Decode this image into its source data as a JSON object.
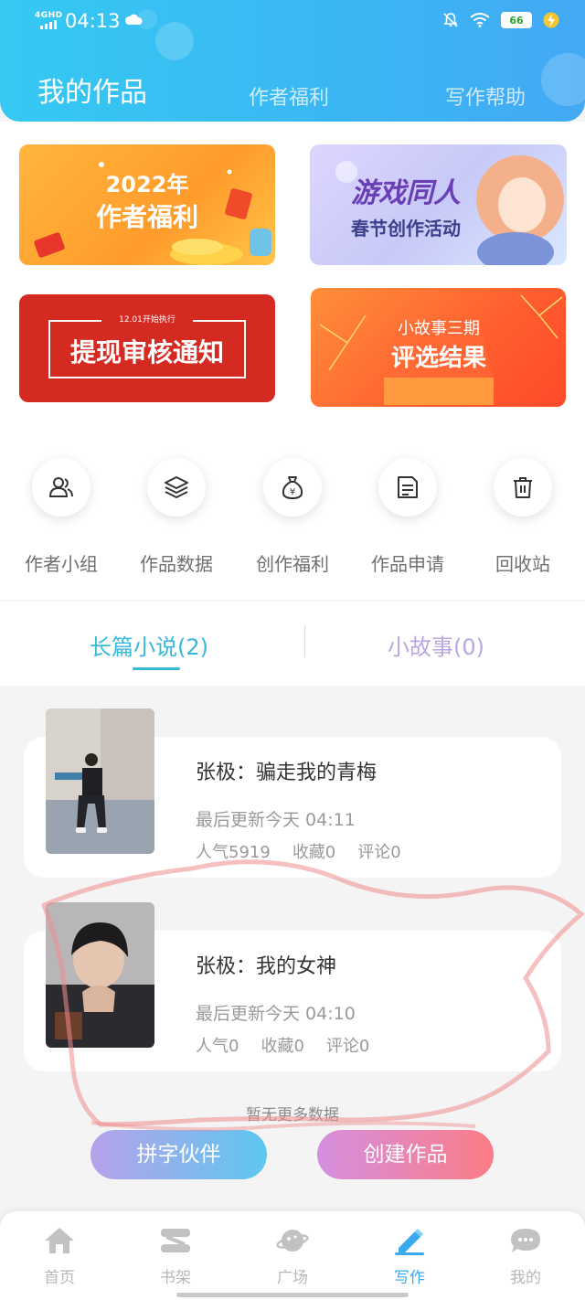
{
  "status_bar": {
    "network": "4GHD",
    "time": "04:13",
    "battery": "66"
  },
  "header": {
    "tabs": [
      {
        "label": "我的作品",
        "active": true
      },
      {
        "label": "作者福利",
        "active": false
      },
      {
        "label": "写作帮助",
        "active": false
      }
    ]
  },
  "banners": [
    {
      "line1": "2022年",
      "line2": "作者福利"
    },
    {
      "line1": "游戏同人",
      "line2": "春节创作活动"
    },
    {
      "line1": "12.01开始执行",
      "line2": "提现审核通知"
    },
    {
      "line1": "小故事三期",
      "line2": "评选结果"
    }
  ],
  "quick_actions": [
    {
      "label": "作者小组",
      "icon": "group-icon"
    },
    {
      "label": "作品数据",
      "icon": "layers-icon"
    },
    {
      "label": "创作福利",
      "icon": "money-bag-icon"
    },
    {
      "label": "作品申请",
      "icon": "document-icon"
    },
    {
      "label": "回收站",
      "icon": "trash-icon"
    }
  ],
  "content_tabs": [
    {
      "label": "长篇小说(2)",
      "active": true
    },
    {
      "label": "小故事(0)",
      "active": false
    }
  ],
  "works": [
    {
      "title": "张极：骗走我的青梅",
      "updated": "最后更新今天 04:11",
      "stats": [
        "人气5919",
        "收藏0",
        "评论0"
      ]
    },
    {
      "title": "张极：我的女神",
      "updated": "最后更新今天 04:10",
      "stats": [
        "人气0",
        "收藏0",
        "评论0"
      ]
    }
  ],
  "list_footer": "暂无更多数据",
  "actions": {
    "partner": "拼字伙伴",
    "create": "创建作品"
  },
  "bottom_nav": [
    {
      "label": "首页",
      "icon": "home-icon",
      "active": false
    },
    {
      "label": "书架",
      "icon": "bookshelf-icon",
      "active": false
    },
    {
      "label": "广场",
      "icon": "planet-icon",
      "active": false
    },
    {
      "label": "写作",
      "icon": "pen-icon",
      "active": true
    },
    {
      "label": "我的",
      "icon": "chat-bubble-icon",
      "active": false
    }
  ],
  "colors": {
    "accent": "#36b9d9",
    "header_blue": "#3ab7f3",
    "nav_active": "#3ba9ee"
  }
}
